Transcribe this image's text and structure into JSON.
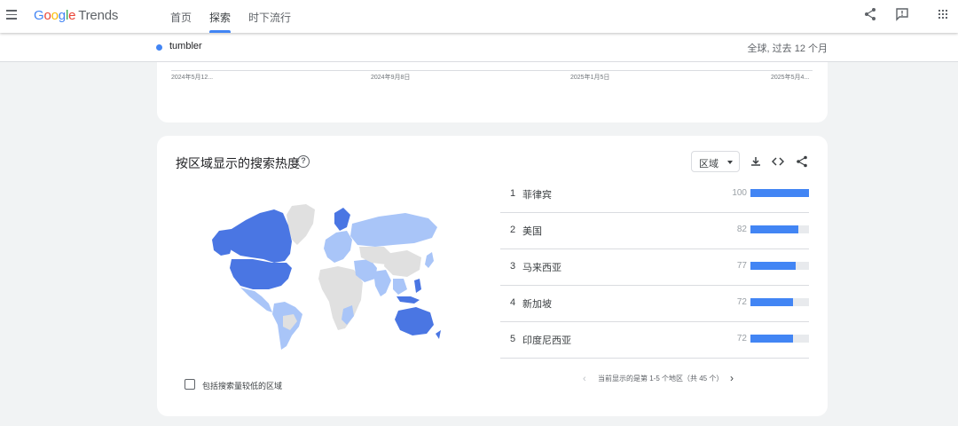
{
  "header": {
    "logo": {
      "google": "Google",
      "trends": "Trends"
    },
    "nav": [
      {
        "label": "首页",
        "active": false
      },
      {
        "label": "探索",
        "active": true
      },
      {
        "label": "时下流行",
        "active": false
      }
    ],
    "icons": [
      "share-icon",
      "feedback-icon",
      "apps-grid-icon"
    ]
  },
  "subbar": {
    "term": "tumbler",
    "term_color": "#4285f4",
    "scope": "全球, 过去 12 个月"
  },
  "timeline": {
    "x_labels": [
      "2024年5月12...",
      "2024年9月8日",
      "2025年1月5日",
      "2025年5月4..."
    ]
  },
  "region_card": {
    "title": "按区域显示的搜索热度",
    "help_icon": "help-circle-icon",
    "resolution_select": "区域",
    "icons": [
      "download-icon",
      "embed-code-icon",
      "share-icon"
    ],
    "low_volume_checkbox": {
      "label": "包括搜索量较低的区域",
      "checked": false
    },
    "map_colors": {
      "high": "#4a76e3",
      "mid": "#a9c5f8",
      "none": "#e0e0e0"
    },
    "rankings": [
      {
        "rank": "1",
        "name": "菲律宾",
        "value": "100",
        "score": 100
      },
      {
        "rank": "2",
        "name": "美国",
        "value": "82",
        "score": 82
      },
      {
        "rank": "3",
        "name": "马来西亚",
        "value": "77",
        "score": 77
      },
      {
        "rank": "4",
        "name": "新加坡",
        "value": "72",
        "score": 72
      },
      {
        "rank": "5",
        "name": "印度尼西亚",
        "value": "72",
        "score": 72
      }
    ],
    "pager_text": "当前显示的是第 1-5 个地区（共 45 个）"
  }
}
